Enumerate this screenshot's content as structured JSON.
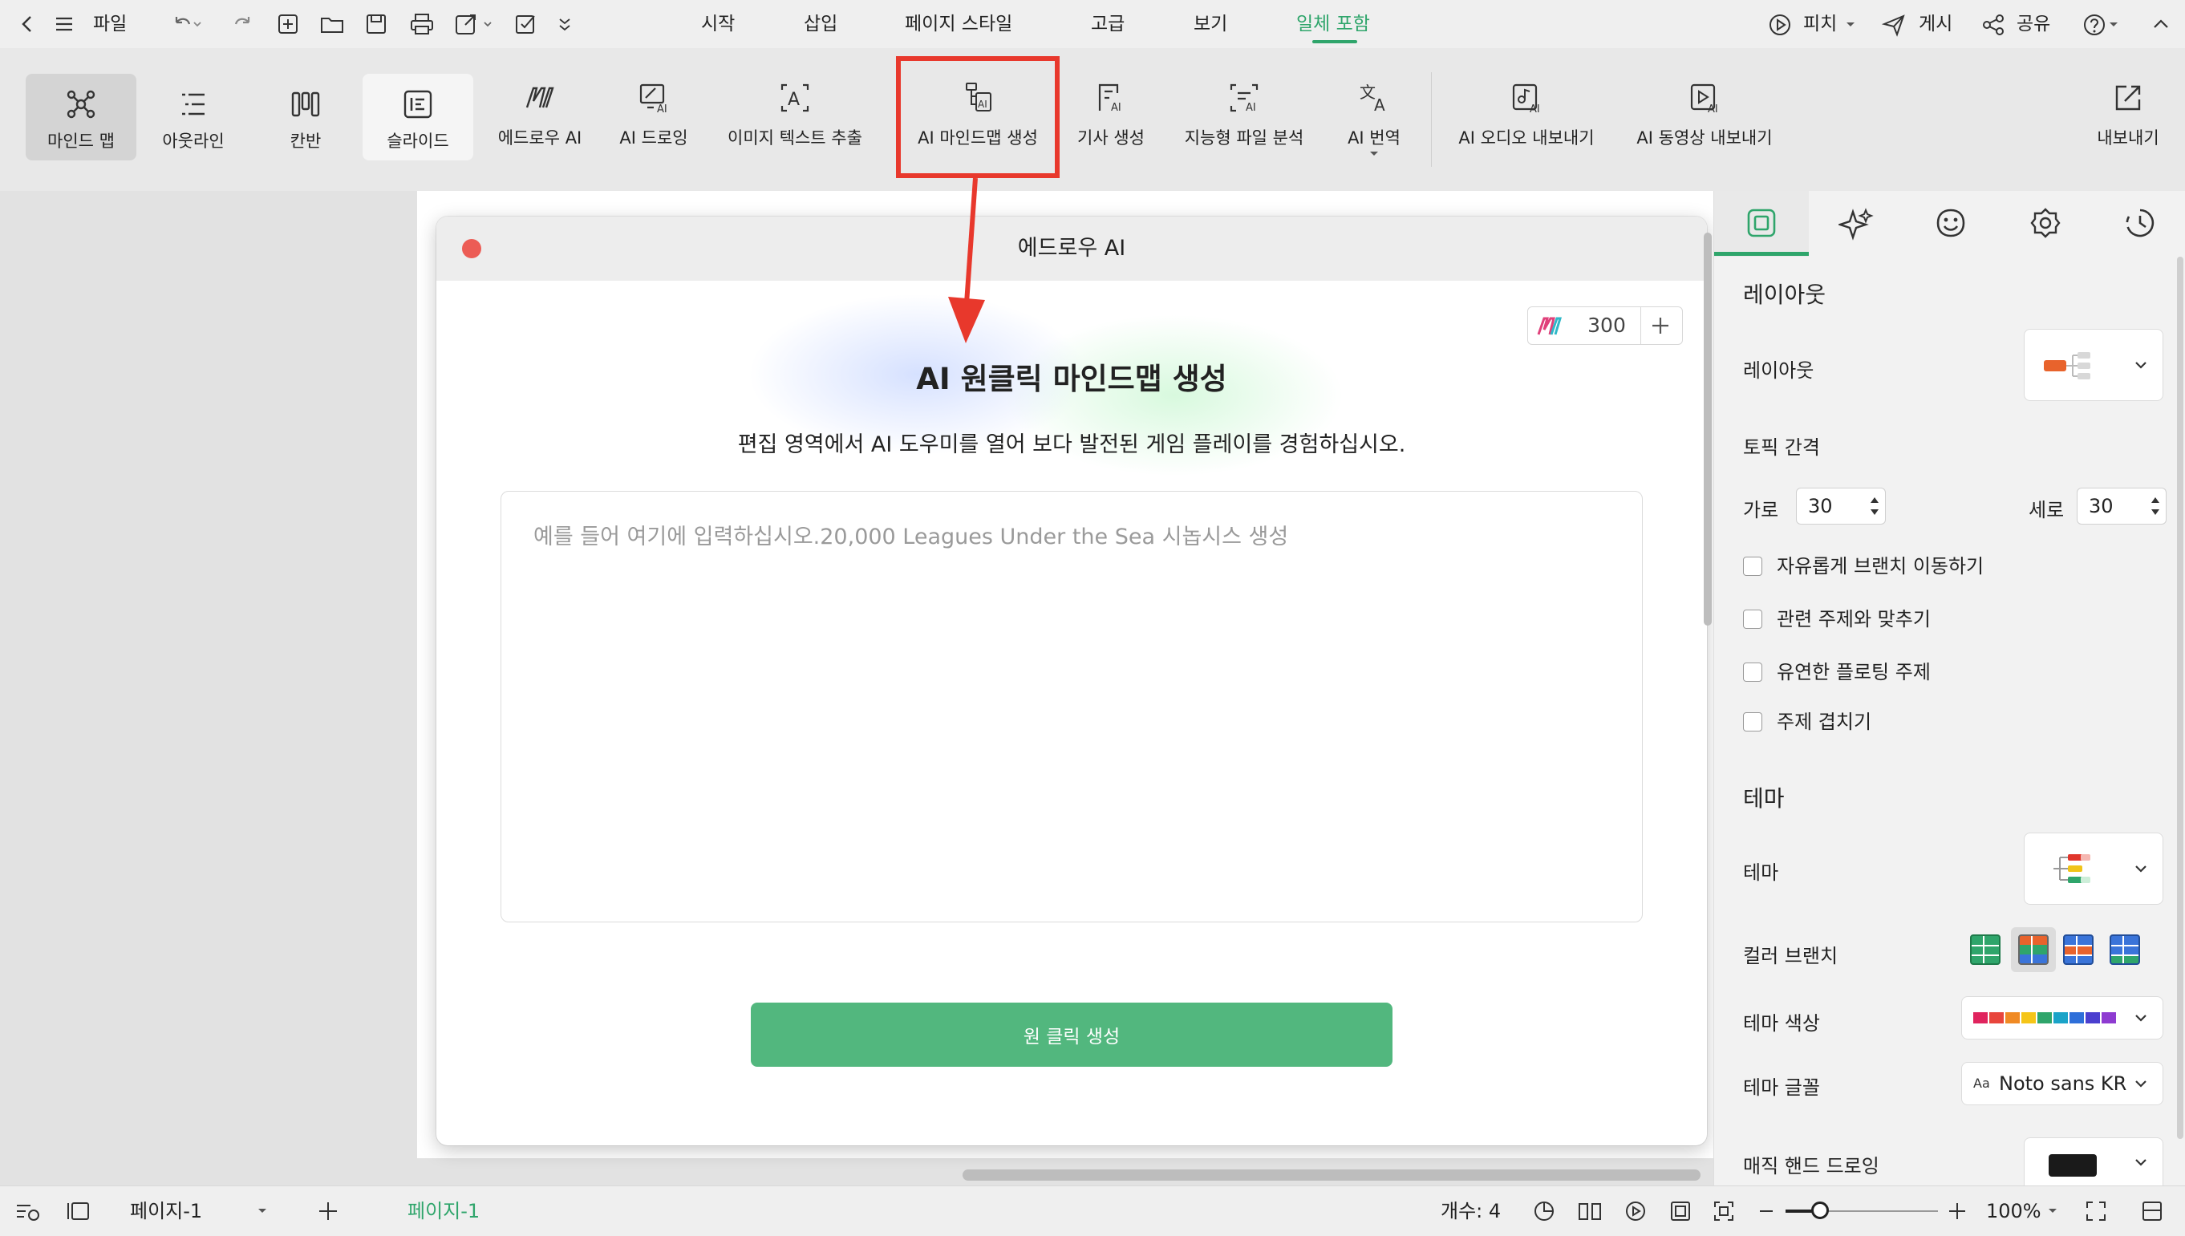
{
  "topbar": {
    "file_label": "파일",
    "tabs": [
      "시작",
      "삽입",
      "페이지 스타일",
      "고급",
      "보기",
      "일체 포함"
    ],
    "active_tab": "일체 포함",
    "right": {
      "pitch": "피치",
      "publish": "게시",
      "share": "공유"
    }
  },
  "ribbon": {
    "views": [
      "마인드 맵",
      "아웃라인",
      "칸반",
      "슬라이드"
    ],
    "selected_view": "마인드 맵",
    "tools": [
      "에드로우 AI",
      "AI 드로잉",
      "이미지 텍스트 추출",
      "AI 마인드맵 생성",
      "기사 생성",
      "지능형 파일 분석",
      "AI 번역",
      "AI 오디오 내보내기",
      "AI 동영상 내보내기"
    ],
    "highlighted_tool": "AI 마인드맵 생성",
    "export_label": "내보내기"
  },
  "dialog": {
    "title": "에드로우 AI",
    "credits": "300",
    "heading": "AI 원클릭 마인드맵 생성",
    "subtitle": "편집 영역에서 AI 도우미를 열어 보다 발전된 게임 플레이를 경험하십시오.",
    "prompt_placeholder": "예를 들어 여기에 입력하십시오.20,000 Leagues Under the Sea 시놉시스 생성",
    "prompt_value": "",
    "generate_label": "원 클릭 생성"
  },
  "panel": {
    "layout_section": "레이아웃",
    "layout_label": "레이아웃",
    "spacing_label": "토픽 간격",
    "horizontal_label": "가로",
    "horizontal_value": "30",
    "vertical_label": "세로",
    "vertical_value": "30",
    "checkboxes": [
      "자유롭게 브랜치 이동하기",
      "관련 주제와 맞추기",
      "유연한 플로팅 주제",
      "주제 겹치기"
    ],
    "theme_section": "테마",
    "theme_label": "테마",
    "color_branch_label": "컬러 브랜치",
    "theme_color_label": "테마 색상",
    "theme_font_label": "테마 글꼴",
    "theme_font_value": "Noto sans KR",
    "theme_font_prefix": "Aa",
    "magic_hand_label": "매직 핸드 드로잉",
    "theme_swatches": [
      "#e0245e",
      "#e8453c",
      "#f08a24",
      "#f5c518",
      "#2fa56b",
      "#1aa3c8",
      "#2e6fd9",
      "#4b3fcf",
      "#8e3bd1"
    ]
  },
  "statusbar": {
    "page_select": "페이지-1",
    "page_tab": "페이지-1",
    "count": "개수: 4",
    "zoom": "100%"
  },
  "colors": {
    "accent": "#2fa56b",
    "generate_button": "#52b77e",
    "highlight": "#e8382c"
  }
}
